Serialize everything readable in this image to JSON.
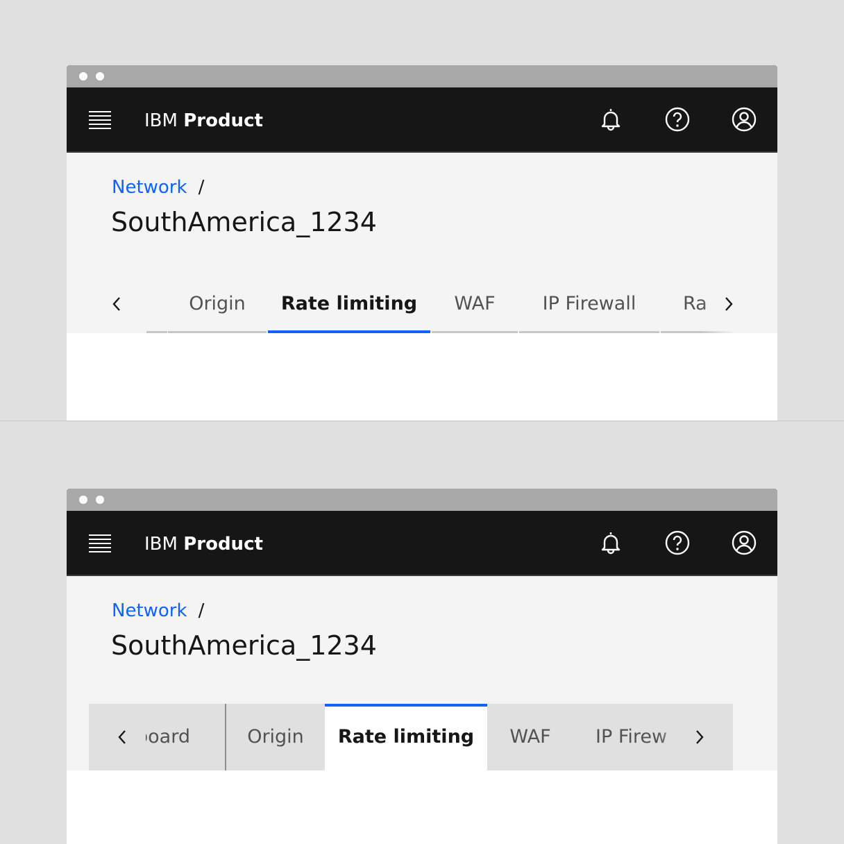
{
  "colors": {
    "shell_bg": "#161616",
    "accent": "#0f62fe",
    "page_bg": "#f4f4f4",
    "tab_line": "#c6c6c6",
    "contained_tab_bg": "#e0e0e0"
  },
  "examples": [
    {
      "variant": "line-tabs",
      "header": {
        "brand_prefix": "IBM",
        "brand_name": "Product"
      },
      "actions": [
        "notification-icon",
        "help-icon",
        "user-avatar-icon"
      ],
      "breadcrumb": {
        "link": "Network",
        "separator": "/"
      },
      "title": "SouthAmerica_1234",
      "tabs": [
        "Origin",
        "Rate limiting",
        "WAF",
        "IP Firewall",
        "Ra"
      ],
      "selected_tab": "Rate limiting"
    },
    {
      "variant": "contained-tabs",
      "header": {
        "brand_prefix": "IBM",
        "brand_name": "Product"
      },
      "actions": [
        "notification-icon",
        "help-icon",
        "user-avatar-icon"
      ],
      "breadcrumb": {
        "link": "Network",
        "separator": "/"
      },
      "title": "SouthAmerica_1234",
      "tabs": [
        "board",
        "Origin",
        "Rate limiting",
        "WAF",
        "IP Firew"
      ],
      "selected_tab": "Rate limiting"
    }
  ]
}
